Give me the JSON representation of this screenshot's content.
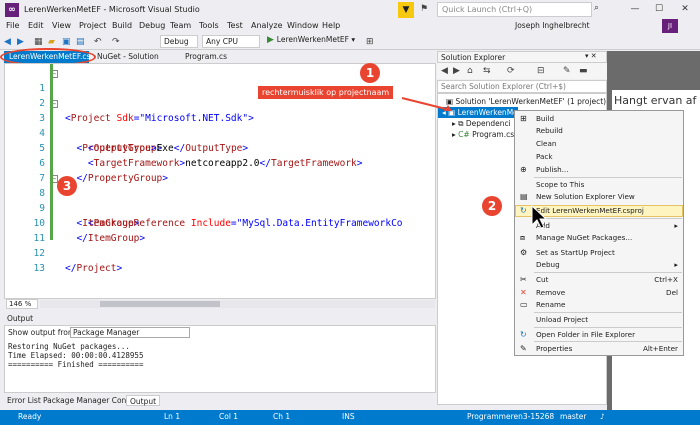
{
  "window": {
    "title": "LerenWerkenMetEF - Microsoft Visual Studio",
    "quick_launch_placeholder": "Quick Launch (Ctrl+Q)",
    "user": "Joseph Inghelbrecht",
    "avatar_initials": "JI"
  },
  "menu": [
    "File",
    "Edit",
    "View",
    "Project",
    "Build",
    "Debug",
    "Team",
    "Tools",
    "Test",
    "Analyze",
    "Window",
    "Help"
  ],
  "toolbar": {
    "config": "Debug",
    "platform": "Any CPU",
    "start_target": "LerenWerkenMetEF"
  },
  "tabs": {
    "active": "LerenWerkenMetEF.csproj",
    "nuget": "NuGet - Solution",
    "program": "Program.cs"
  },
  "code": {
    "line_numbers": [
      "1",
      "2",
      "3",
      "4",
      "5",
      "6",
      "7",
      "8",
      "9",
      "10",
      "11",
      "12",
      "13"
    ],
    "l1_tag": "Project",
    "l1_attr": "Sdk",
    "l1_val": "\"Microsoft.NET.Sdk\"",
    "l3_tag": "PropertyGroup",
    "l4_tag": "OutputType",
    "l4_text": "Exe",
    "l5_tag": "TargetFramework",
    "l5_text": "netcoreapp2.0",
    "l8_tag": "ItemGroup",
    "l9_tag": "PackageReference",
    "l9_attr": "Include",
    "l9_val": "\"MySql.Data.EntityFrameworkCo"
  },
  "editor": {
    "zoom": "146 %"
  },
  "output": {
    "title": "Output",
    "show_from_label": "Show output from:",
    "source": "Package Manager",
    "lines": [
      "Restoring NuGet packages...",
      "Time Elapsed: 00:00:00.4128955",
      "========== Finished =========="
    ]
  },
  "bottom_tabs": [
    "Error List",
    "Package Manager Console",
    "Output"
  ],
  "status": {
    "ready": "Ready",
    "line": "Ln 1",
    "col": "Col 1",
    "char": "Ch 1",
    "ins": "INS",
    "repo": "Programmeren3-15268",
    "branch": "master"
  },
  "solution_explorer": {
    "title": "Solution Explorer",
    "search_placeholder": "Search Solution Explorer (Ctrl+$)",
    "solution": "Solution 'LerenWerkenMetEF' (1 project)",
    "project": "LerenWerkenMet",
    "dependencies": "Dependenci",
    "program": "Program.cs"
  },
  "background_text": "Hangt ervan af",
  "context_menu": {
    "items": [
      {
        "label": "Build",
        "shortcut": ""
      },
      {
        "label": "Rebuild",
        "shortcut": ""
      },
      {
        "label": "Clean",
        "shortcut": ""
      },
      {
        "label": "Pack",
        "shortcut": ""
      },
      {
        "label": "Publish...",
        "shortcut": ""
      },
      {
        "label": "Scope to This",
        "shortcut": ""
      },
      {
        "label": "New Solution Explorer View",
        "shortcut": ""
      },
      {
        "label": "Edit LerenWerkenMetEF.csproj",
        "shortcut": ""
      },
      {
        "label": "Add",
        "shortcut": "▸"
      },
      {
        "label": "Manage NuGet Packages...",
        "shortcut": ""
      },
      {
        "label": "Set as StartUp Project",
        "shortcut": ""
      },
      {
        "label": "Debug",
        "shortcut": "▸"
      },
      {
        "label": "Cut",
        "shortcut": "Ctrl+X"
      },
      {
        "label": "Remove",
        "shortcut": "Del"
      },
      {
        "label": "Rename",
        "shortcut": ""
      },
      {
        "label": "Unload Project",
        "shortcut": ""
      },
      {
        "label": "Open Folder in File Explorer",
        "shortcut": ""
      },
      {
        "label": "Properties",
        "shortcut": "Alt+Enter"
      }
    ]
  },
  "annotations": {
    "badge1": "1",
    "badge2": "2",
    "badge3": "3",
    "label": "rechtermuisklik op projectnaam"
  }
}
